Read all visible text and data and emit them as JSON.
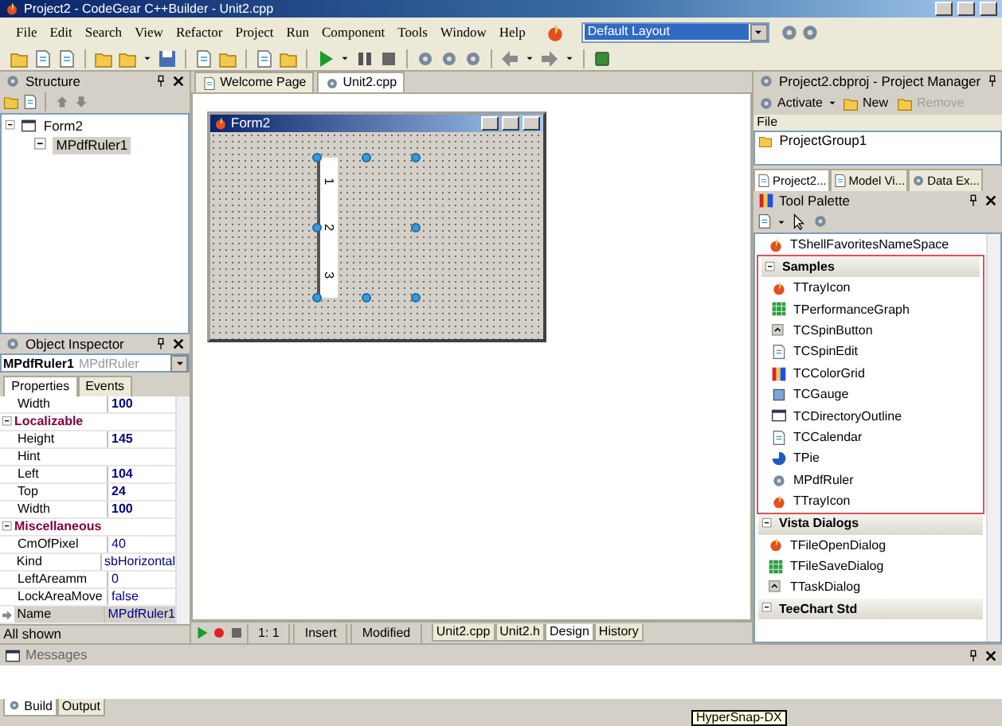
{
  "window": {
    "title": "Project2 - CodeGear C++Builder - Unit2.cpp"
  },
  "menu": [
    "File",
    "Edit",
    "Search",
    "View",
    "Refactor",
    "Project",
    "Run",
    "Component",
    "Tools",
    "Window",
    "Help"
  ],
  "layout_combo": {
    "value": "Default Layout"
  },
  "structure": {
    "title": "Structure",
    "tree": [
      {
        "label": "Form2",
        "expanded": true,
        "selected": false,
        "children": [
          {
            "label": "MPdfRuler1",
            "selected": true
          }
        ]
      }
    ]
  },
  "object_inspector": {
    "title": "Object Inspector",
    "object_name": "MPdfRuler1",
    "object_type": "MPdfRuler",
    "tabs": [
      {
        "label": "Properties",
        "selected": true
      },
      {
        "label": "Events",
        "selected": false
      }
    ],
    "rows": [
      {
        "kind": "property",
        "name": "Width",
        "value": "100",
        "modified": true,
        "selected": false
      },
      {
        "kind": "category",
        "name": "Localizable",
        "expanded": true
      },
      {
        "kind": "property",
        "name": "Height",
        "value": "145",
        "modified": true,
        "selected": false
      },
      {
        "kind": "property",
        "name": "Hint",
        "selected": false
      },
      {
        "kind": "property",
        "name": "Left",
        "value": "104",
        "modified": true,
        "selected": false
      },
      {
        "kind": "property",
        "name": "Top",
        "value": "24",
        "modified": true,
        "selected": false
      },
      {
        "kind": "property",
        "name": "Width",
        "value": "100",
        "modified": true,
        "selected": false
      },
      {
        "kind": "category",
        "name": "Miscellaneous",
        "expanded": true
      },
      {
        "kind": "property",
        "name": "CmOfPixel",
        "value": "40",
        "modified": false,
        "selected": false
      },
      {
        "kind": "property",
        "name": "Kind",
        "value": "sbHorizontal",
        "modified": false,
        "selected": false
      },
      {
        "kind": "property",
        "name": "LeftAreamm",
        "value": "0",
        "modified": false,
        "selected": false
      },
      {
        "kind": "property",
        "name": "LockAreaMove",
        "value": "false",
        "modified": false,
        "selected": false
      },
      {
        "kind": "property",
        "name": "Name",
        "value": "MPdfRuler1",
        "modified": false,
        "selected": true
      }
    ],
    "status": "All shown"
  },
  "editor": {
    "tabs": [
      {
        "label": "Welcome Page",
        "selected": false
      },
      {
        "label": "Unit2.cpp",
        "selected": true
      }
    ],
    "form": {
      "title": "Form2",
      "ruler_marks": [
        "1",
        "2",
        "3"
      ]
    },
    "status": {
      "position": "1: 1",
      "mode": "Insert",
      "state": "Modified"
    },
    "view_tabs": [
      {
        "label": "Unit2.cpp",
        "selected": false
      },
      {
        "label": "Unit2.h",
        "selected": false
      },
      {
        "label": "Design",
        "selected": true
      },
      {
        "label": "History",
        "selected": false
      }
    ]
  },
  "project_manager": {
    "title": "Project2.cbproj - Project Manager",
    "buttons": [
      {
        "label": "Activate",
        "disabled": false
      },
      {
        "label": "New",
        "disabled": false
      },
      {
        "label": "Remove",
        "disabled": true
      }
    ],
    "column": "File",
    "tree": [
      "ProjectGroup1"
    ],
    "tabs": [
      {
        "label": "Project2...",
        "selected": true
      },
      {
        "label": "Model Vi...",
        "selected": false
      },
      {
        "label": "Data Ex...",
        "selected": false
      }
    ]
  },
  "tool_palette": {
    "title": "Tool Palette",
    "sections": [
      {
        "kind": "loose",
        "items": [
          "TShellFavoritesNameSpace"
        ]
      },
      {
        "kind": "category",
        "title": "Samples",
        "expanded": true,
        "highlighted": true,
        "items": [
          "TTrayIcon",
          "TPerformanceGraph",
          "TCSpinButton",
          "TCSpinEdit",
          "TCColorGrid",
          "TCGauge",
          "TCDirectoryOutline",
          "TCCalendar",
          "TPie",
          "MPdfRuler",
          "TTrayIcon"
        ]
      },
      {
        "kind": "category",
        "title": "Vista Dialogs",
        "expanded": true,
        "highlighted": false,
        "items": [
          "TFileOpenDialog",
          "TFileSaveDialog",
          "TTaskDialog"
        ]
      },
      {
        "kind": "category",
        "title": "TeeChart Std",
        "expanded": true,
        "highlighted": false
      }
    ]
  },
  "messages": {
    "title": "Messages",
    "tabs": [
      {
        "label": "Build",
        "selected": true
      },
      {
        "label": "Output",
        "selected": false
      }
    ]
  },
  "taskbar_tooltip": "HyperSnap-DX"
}
